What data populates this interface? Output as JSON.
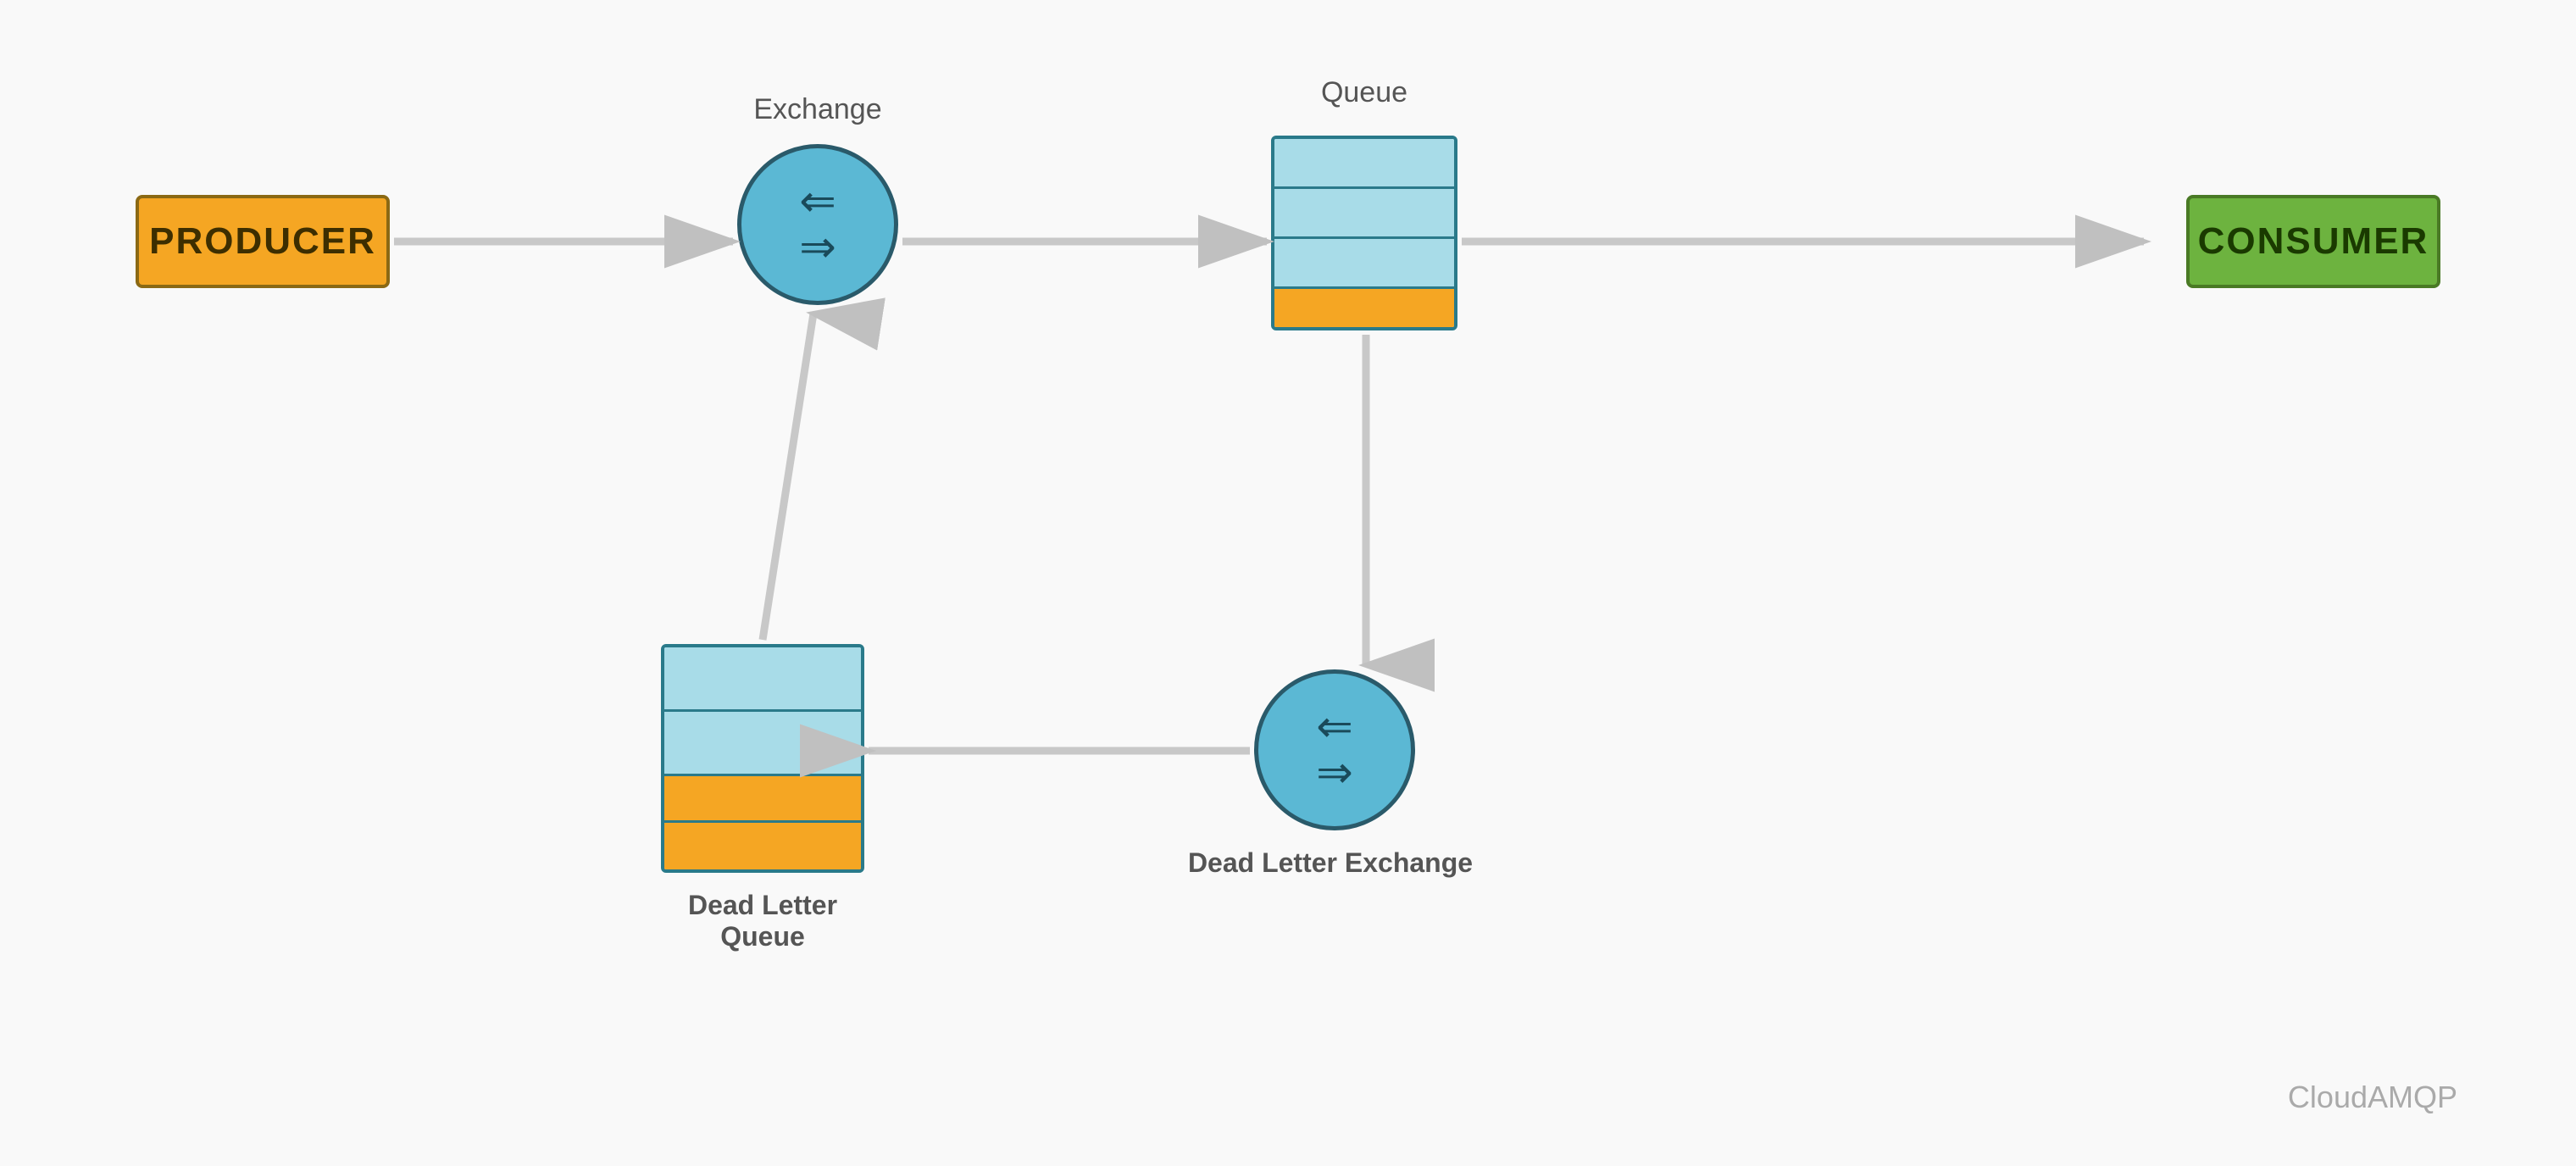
{
  "producer": {
    "label": "PRODUCER",
    "bg_color": "#F5A623",
    "border_color": "#8B6914"
  },
  "consumer": {
    "label": "CONSUMER",
    "bg_color": "#6DB33F",
    "border_color": "#4a7a25"
  },
  "exchange": {
    "label": "Exchange",
    "bg_color": "#5BB8D4",
    "border_color": "#2a5a6a"
  },
  "queue": {
    "label": "Queue"
  },
  "dl_exchange": {
    "label": "Dead Letter Exchange"
  },
  "dl_queue": {
    "label": "Dead Letter\nQueue"
  },
  "watermark": {
    "text": "CloudAMQP"
  }
}
